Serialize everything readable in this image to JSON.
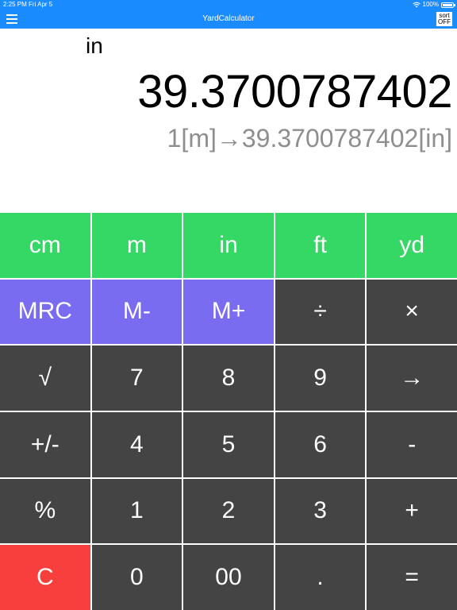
{
  "status": {
    "time": "2:25 PM",
    "date": "Fri Apr 5",
    "battery": "100%"
  },
  "nav": {
    "title": "YardCalculator",
    "sort_line1": "sort",
    "sort_line2": "OFF"
  },
  "display": {
    "unit": "in",
    "value": "39.3700787402",
    "expression": "1[m]→39.3700787402[in]"
  },
  "keys": {
    "cm": "cm",
    "m": "m",
    "in": "in",
    "ft": "ft",
    "yd": "yd",
    "mrc": "MRC",
    "mminus": "M-",
    "mplus": "M+",
    "divide": "÷",
    "multiply": "×",
    "sqrt": "√",
    "seven": "7",
    "eight": "8",
    "nine": "9",
    "convert": "→",
    "sign": "+/-",
    "four": "4",
    "five": "5",
    "six": "6",
    "minus": "-",
    "percent": "%",
    "one": "1",
    "two": "2",
    "three": "3",
    "plus": "+",
    "clear": "C",
    "zero": "0",
    "doublezero": "00",
    "dot": ".",
    "equals": "="
  },
  "colors": {
    "nav": "#1a8cff",
    "unit_keys": "#35d765",
    "memory_keys": "#7a6cf0",
    "dark_keys": "#444444",
    "clear_key": "#f7403e"
  }
}
